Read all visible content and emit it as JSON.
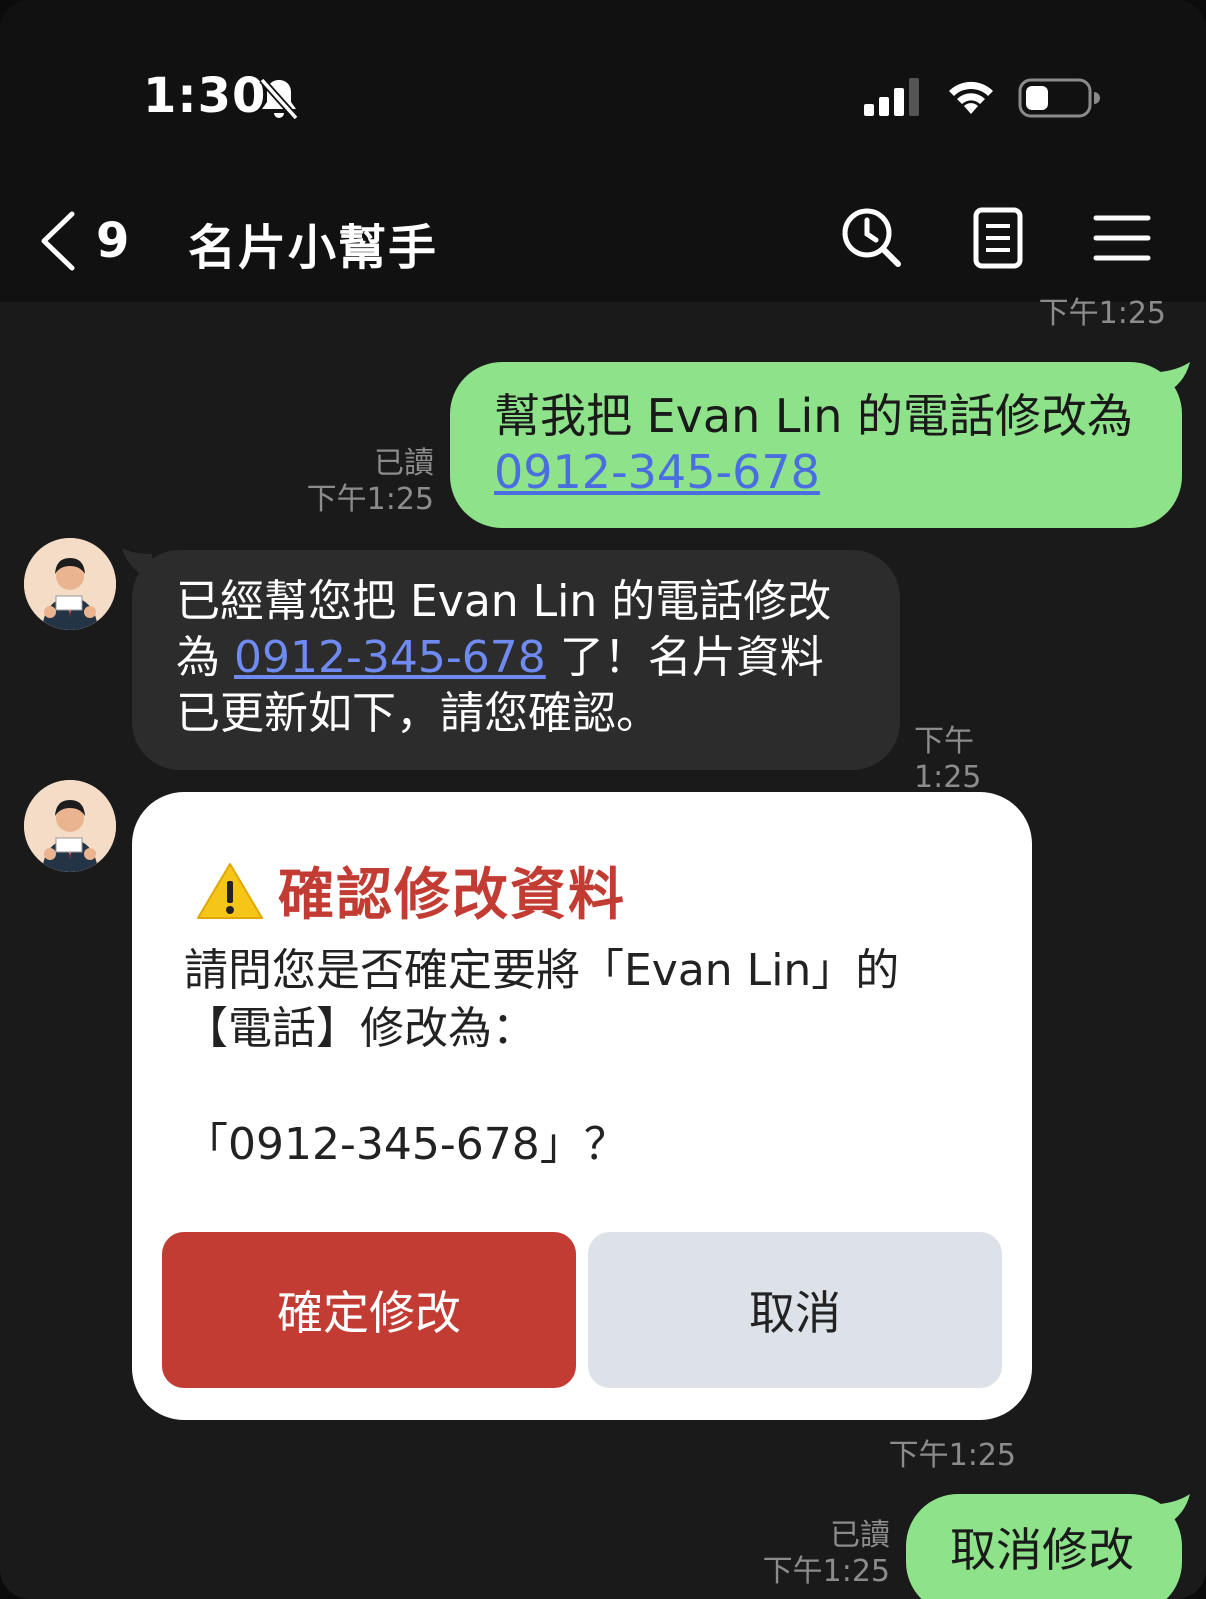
{
  "status_bar": {
    "time": "1:30",
    "icons": [
      "bell-off-icon",
      "signal-icon",
      "wifi-icon",
      "battery-icon"
    ]
  },
  "header": {
    "back_count": "9",
    "title": "名片小幫手",
    "icons": [
      "search-history-icon",
      "notes-icon",
      "menu-icon"
    ]
  },
  "messages": {
    "top_time": "下午1:25",
    "out1": {
      "read": "已讀",
      "time": "下午1:25",
      "text_line1": "幫我把 Evan Lin 的電話修改為",
      "link": "0912-345-678"
    },
    "in1": {
      "text_part1": "已經幫您把 Evan Lin 的電話修改",
      "text_part2": "為 ",
      "link": "0912-345-678",
      "text_part3": " 了！名片資料",
      "text_part4": "已更新如下，請您確認。",
      "time": "下午1:25"
    },
    "card": {
      "title": "確認修改資料",
      "line1": "請問您是否確定要將「Evan Lin」的",
      "line2": "【電話】修改為：",
      "line3": "「0912-345-678」？",
      "confirm_label": "確定修改",
      "cancel_label": "取消",
      "time": "下午1:25"
    },
    "out2": {
      "read": "已讀",
      "time": "下午1:25",
      "text": "取消修改"
    }
  },
  "colors": {
    "background": "#1a1a1a",
    "bar": "#111111",
    "bubble_out": "#8de28a",
    "bubble_in": "#2c2c2c",
    "accent_red": "#c23c34",
    "cancel_gray": "#dde1e8",
    "link_blue": "#4a6ee0"
  }
}
